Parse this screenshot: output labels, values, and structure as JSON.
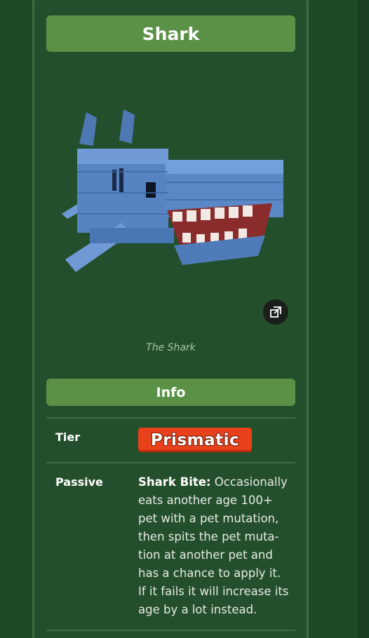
{
  "pet": {
    "name": "Shark",
    "caption": "The Shark"
  },
  "sections": {
    "info_label": "Info"
  },
  "rows": {
    "tier_label": "Tier",
    "tier_value": "Prismatic",
    "passive_label": "Passive",
    "passive_name": "Shark Bite:",
    "passive_desc_lines": [
      " Occasionally",
      "eats another age 100+",
      "pet with a pet mutation,",
      "then spits the pet muta-",
      "tion at another pet and",
      "has a chance to apply it.",
      "If it fails it will increase its",
      "age by a lot instead."
    ]
  },
  "colors": {
    "background": "#1e4a26",
    "card": "#244f2c",
    "header_green": "#5a9146",
    "prismatic_badge": "#e8421c"
  },
  "icons": {
    "expand": "expand-image-icon"
  }
}
